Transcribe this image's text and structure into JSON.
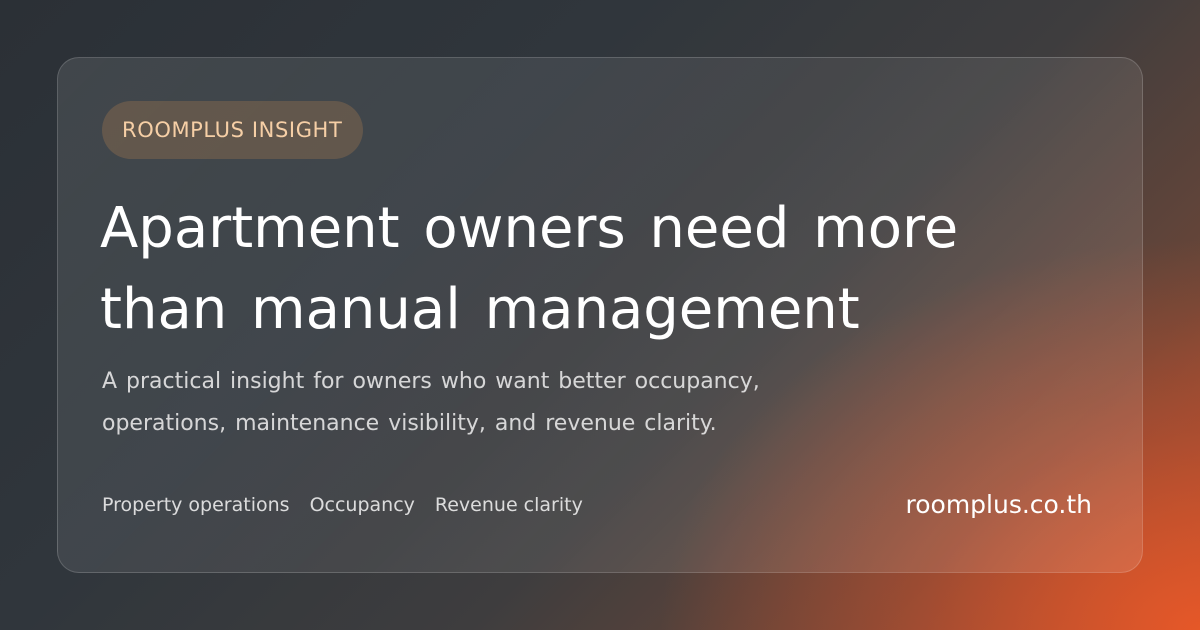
{
  "badge": {
    "label": "ROOMPLUS INSIGHT"
  },
  "headline": {
    "line1": "Apartment owners need more",
    "line2": "than manual management"
  },
  "subtitle": {
    "line1": "A practical insight for owners who want better occupancy,",
    "line2": "operations, maintenance visibility, and revenue clarity."
  },
  "tags": [
    "Property operations",
    "Occupancy",
    "Revenue clarity"
  ],
  "site": {
    "url": "roomplus.co.th"
  },
  "colors": {
    "badge_text": "#f6cfa6",
    "accent_orange": "#e85828",
    "background_dark": "#2b3036"
  }
}
